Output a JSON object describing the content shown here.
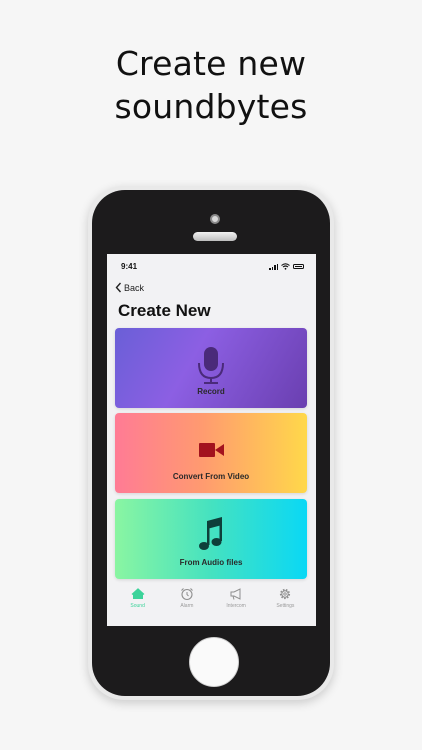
{
  "headline": {
    "line1": "Create new",
    "line2": "soundbytes"
  },
  "status_bar": {
    "time": "9:41"
  },
  "nav": {
    "back_label": "Back"
  },
  "page": {
    "title": "Create New"
  },
  "cards": [
    {
      "label": "Record",
      "icon": "microphone-icon"
    },
    {
      "label": "Convert From Video",
      "icon": "video-camera-icon"
    },
    {
      "label": "From Audio files",
      "icon": "music-note-icon"
    }
  ],
  "tab_bar": {
    "items": [
      {
        "label": "Sound",
        "icon": "home-icon",
        "active": true
      },
      {
        "label": "Alarm",
        "icon": "alarm-clock-icon",
        "active": false
      },
      {
        "label": "Intercom",
        "icon": "megaphone-icon",
        "active": false
      },
      {
        "label": "Settings",
        "icon": "gear-icon",
        "active": false
      }
    ],
    "active_color": "#3cd39a",
    "inactive_color": "#9a9a9a"
  }
}
